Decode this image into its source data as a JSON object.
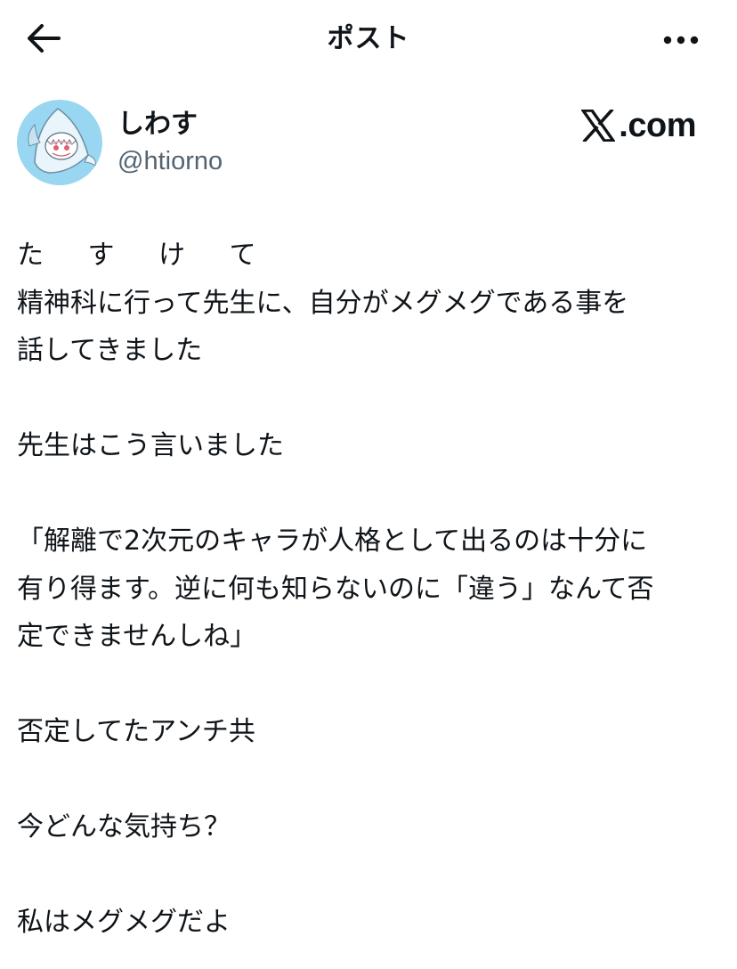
{
  "header": {
    "title": "ポスト",
    "back_icon": "arrow-left-icon",
    "more_icon": "more-horizontal-icon"
  },
  "author": {
    "display_name": "しわす",
    "handle": "@htiorno",
    "avatar_icon": "shark-hood-avatar"
  },
  "brand": {
    "logo_letter_icon": "x-logo-icon",
    "suffix": ".com"
  },
  "post": {
    "lines": [
      "た す け て",
      "精神科に行って先生に、自分がメグメグである事を",
      "話してきました",
      "",
      "先生はこう言いました",
      "",
      "「解離で2次元のキャラが人格として出るのは十分に",
      "有り得ます。逆に何も知らないのに「違う」なんて否",
      "定できませんしね」",
      "",
      "否定してたアンチ共",
      "",
      "今どんな気持ち？",
      "",
      "私はメグメグだよ"
    ]
  },
  "colors": {
    "text_primary": "#0f1419",
    "text_secondary": "#536471",
    "avatar_bg": "#8ad0ee",
    "background": "#ffffff"
  }
}
